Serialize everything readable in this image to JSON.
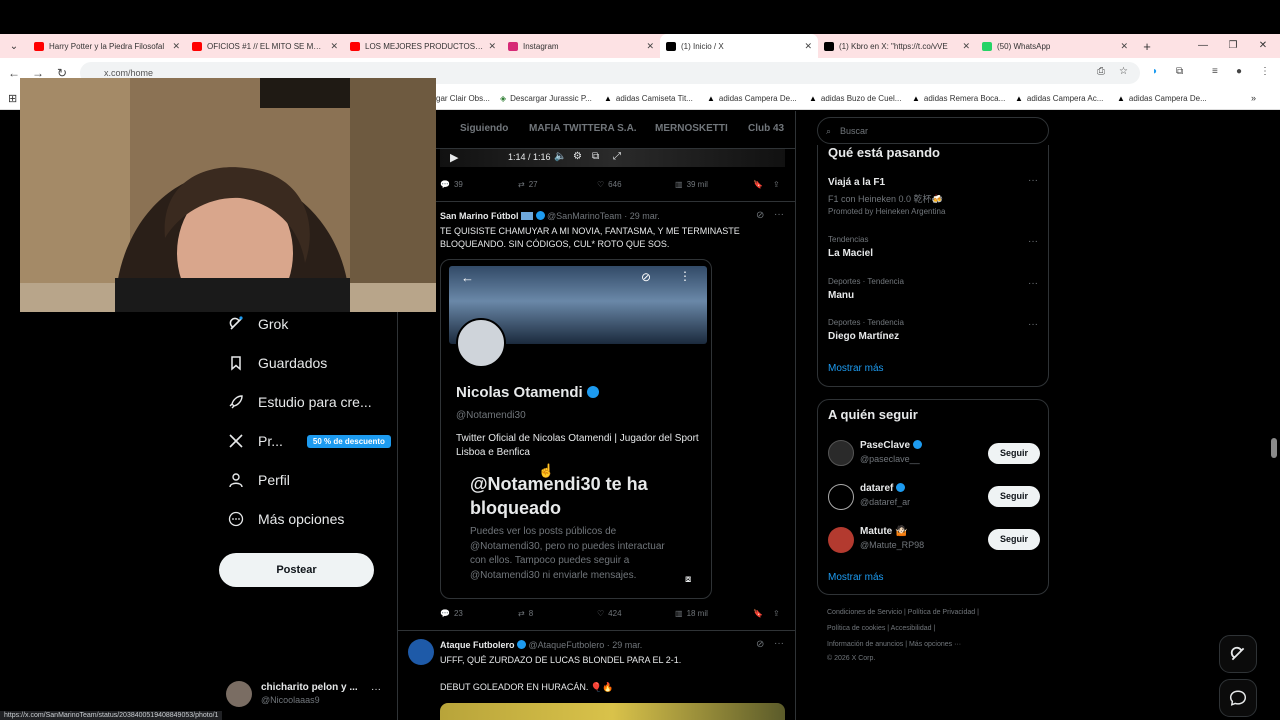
{
  "browser": {
    "tabs": [
      {
        "title": "Harry Potter y la Piedra Filosofal",
        "icon": "youtube-icon",
        "color": "#ff0000"
      },
      {
        "title": "OFICIOS #1 // EL MITO SE METE",
        "icon": "youtube-icon",
        "color": "#ff0000"
      },
      {
        "title": "LOS MEJORES PRODUCTOS QUE",
        "icon": "youtube-icon",
        "color": "#ff0000"
      },
      {
        "title": "Instagram",
        "icon": "instagram-icon",
        "color": "#d62976"
      },
      {
        "title": "(1) Inicio / X",
        "icon": "x-icon",
        "color": "#000000"
      },
      {
        "title": "(1) Kbro en X: \"https://t.co/vVE",
        "icon": "x-icon",
        "color": "#000000"
      },
      {
        "title": "(50) WhatsApp",
        "icon": "whatsapp-icon",
        "color": "#25d366"
      }
    ],
    "active_tab_index": 4,
    "url": "x.com/home",
    "bookmarks": [
      "gar Clair Obs...",
      "Descargar Jurassic P...",
      "adidas Camiseta Tit...",
      "adidas Campera De...",
      "adidas Buzo de Cuel...",
      "adidas Remera Boca...",
      "adidas Campera Ac...",
      "adidas Campera De..."
    ],
    "status_url": "https://x.com/SanMarinoTeam/status/2038400519408849053/photo/1"
  },
  "sidebar": {
    "items": [
      {
        "label": "Grok",
        "icon": "grok-icon"
      },
      {
        "label": "Guardados",
        "icon": "bookmark-icon"
      },
      {
        "label": "Estudio para cre...",
        "icon": "rocket-icon"
      },
      {
        "label": "Pr...",
        "icon": "x-logo-icon"
      },
      {
        "label": "Perfil",
        "icon": "person-icon"
      },
      {
        "label": "Más opciones",
        "icon": "more-circle-icon"
      }
    ],
    "premium_badge": "50 % de descuento",
    "post_button": "Postear",
    "account": {
      "name": "chicharito pelon y ...",
      "handle": "@Nicoolaaas9"
    }
  },
  "timeline": {
    "tabs": [
      "Siguiendo",
      "MAFIA TWITTERA S.A.",
      "MERNOSKETTI",
      "Club 43"
    ],
    "video_time": "1:14 / 1:16",
    "tweets": [
      {
        "actions": {
          "replies": "39",
          "reposts": "27",
          "likes": "646",
          "views": "39 mil"
        }
      },
      {
        "name": "San Marino Fútbol",
        "handle": "@SanMarinoTeam",
        "date": "· 29 mar.",
        "text": "TE QUISISTE CHAMUYAR A MI NOVIA, FANTASMA, Y ME TERMINASTE BLOQUEANDO. SIN CÓDIGOS, CUL* ROTO QUE SOS.",
        "card": {
          "name": "Nicolas Otamendi",
          "handle": "@Notamendi30",
          "bio": "Twitter Oficial de Nicolas Otamendi | Jugador del Sport Lisboa e Benfica",
          "blocked_title": "@Notamendi30 te ha bloqueado",
          "blocked_body": "Puedes ver los posts públicos de @Notamendi30, pero no puedes interactuar con ellos. Tampoco puedes seguir a @Notamendi30 ni enviarle mensajes."
        },
        "actions": {
          "replies": "23",
          "reposts": "8",
          "likes": "424",
          "views": "18 mil"
        }
      },
      {
        "name": "Ataque Futbolero",
        "handle": "@AtaqueFutbolero",
        "date": "· 29 mar.",
        "text": "UFFF, QUÉ ZURDAZO DE LUCAS BLONDEL PARA EL 2-1.",
        "text2": "DEBUT GOLEADOR EN HURACÁN. 🎈🔥"
      }
    ]
  },
  "right": {
    "search_placeholder": "Buscar",
    "trends_title": "Qué está pasando",
    "promo": {
      "title": "Viajá a la F1",
      "subtitle": "F1 con Heineken 0.0 乾杯🍻",
      "promoted": "Promoted by Heineken Argentina"
    },
    "trends": [
      {
        "meta": "Tendencias",
        "name": "La Maciel"
      },
      {
        "meta": "Deportes · Tendencia",
        "name": "Manu"
      },
      {
        "meta": "Deportes · Tendencia",
        "name": "Diego Martínez"
      }
    ],
    "show_more": "Mostrar más",
    "follow_title": "A quién seguir",
    "follow": [
      {
        "name": "PaseClave",
        "handle": "@paseclave__",
        "button": "Seguir"
      },
      {
        "name": "dataref",
        "handle": "@dataref_ar",
        "button": "Seguir"
      },
      {
        "name": "Matute 🤷🏻",
        "handle": "@Matute_RP98",
        "button": "Seguir"
      }
    ],
    "footer": {
      "line1": "Condiciones de Servicio   |   Política de Privacidad   |",
      "line2": "Política de cookies   |   Accesibilidad   |",
      "line3": "Información de anuncios   |   Más opciones ···",
      "line4": "© 2026 X Corp."
    }
  },
  "colors": {
    "accent": "#1d9bf0",
    "tabbar": "#fde2e4",
    "background": "#000000"
  }
}
